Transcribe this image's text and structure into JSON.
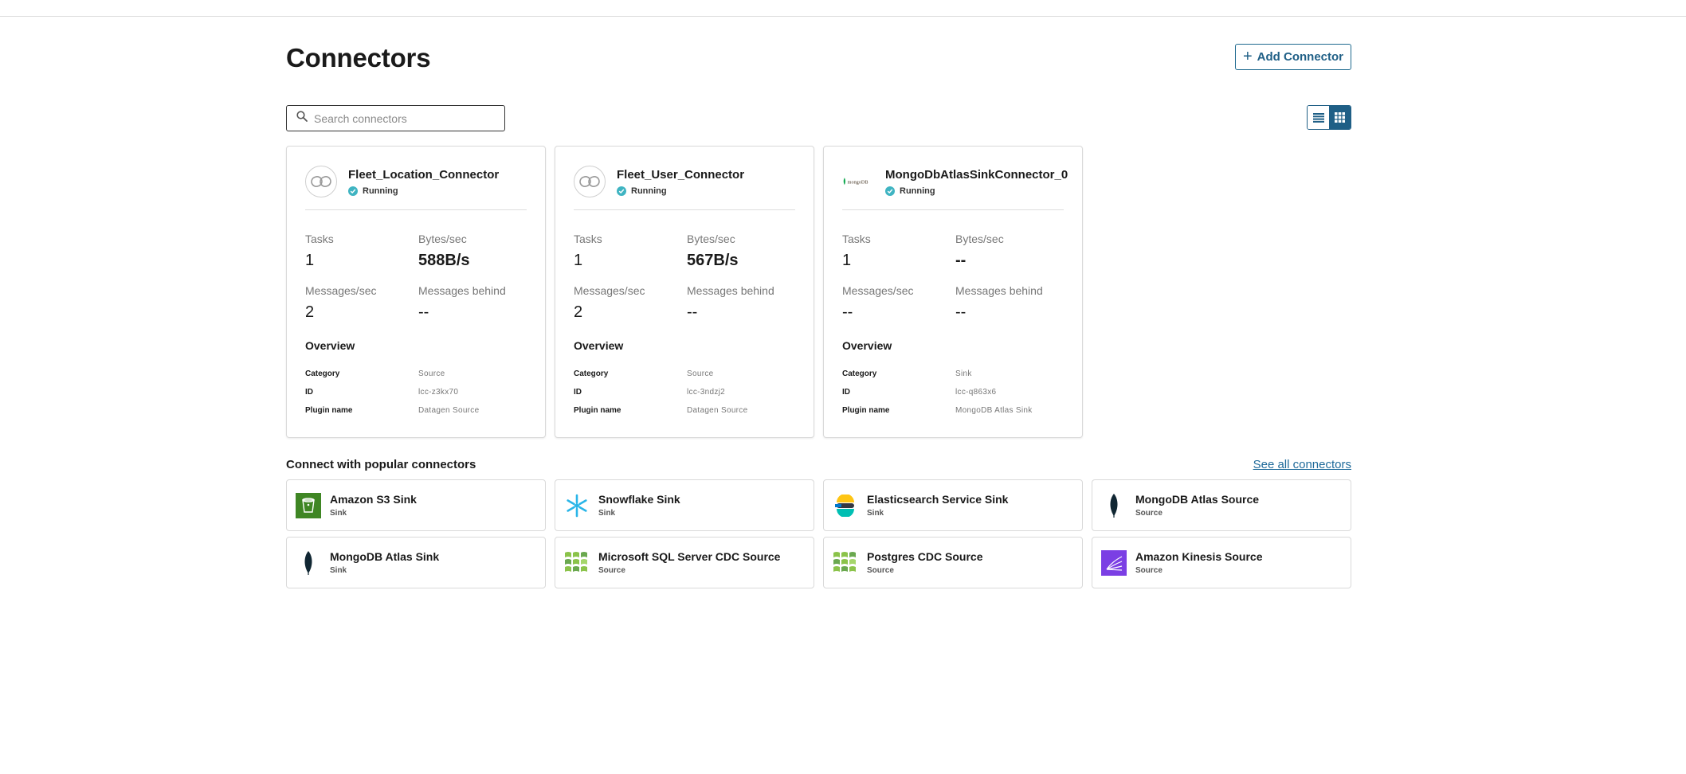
{
  "header": {
    "title": "Connectors",
    "add_button_label": "Add Connector"
  },
  "search": {
    "placeholder": "Search connectors",
    "value": ""
  },
  "view_toggle": {
    "selected": "grid"
  },
  "labels": {
    "tasks": "Tasks",
    "bytes_sec": "Bytes/sec",
    "messages_sec": "Messages/sec",
    "messages_behind": "Messages behind",
    "overview": "Overview",
    "category": "Category",
    "id": "ID",
    "plugin_name": "Plugin name"
  },
  "connectors": [
    {
      "name": "Fleet_Location_Connector",
      "status": "Running",
      "tasks": "1",
      "bytes_sec": "588B/s",
      "messages_sec": "2",
      "messages_behind": "--",
      "category": "Source",
      "id": "lcc-z3kx70",
      "plugin_name": "Datagen Source",
      "logo": "datagen-link-icon"
    },
    {
      "name": "Fleet_User_Connector",
      "status": "Running",
      "tasks": "1",
      "bytes_sec": "567B/s",
      "messages_sec": "2",
      "messages_behind": "--",
      "category": "Source",
      "id": "lcc-3ndzj2",
      "plugin_name": "Datagen Source",
      "logo": "datagen-link-icon"
    },
    {
      "name": "MongoDbAtlasSinkConnector_0",
      "status": "Running",
      "tasks": "1",
      "bytes_sec": "--",
      "messages_sec": "--",
      "messages_behind": "--",
      "category": "Sink",
      "id": "lcc-q863x6",
      "plugin_name": "MongoDB Atlas Sink",
      "logo": "mongodb-logo",
      "logo_text": "mongoDB"
    }
  ],
  "popular": {
    "title": "Connect with popular connectors",
    "see_all": "See all connectors",
    "items": [
      {
        "name": "Amazon S3 Sink",
        "type": "Sink",
        "icon": "amazon-s3-icon"
      },
      {
        "name": "Snowflake Sink",
        "type": "Sink",
        "icon": "snowflake-icon"
      },
      {
        "name": "Elasticsearch Service Sink",
        "type": "Sink",
        "icon": "elasticsearch-icon"
      },
      {
        "name": "MongoDB Atlas Source",
        "type": "Source",
        "icon": "mongodb-leaf-icon"
      },
      {
        "name": "MongoDB Atlas Sink",
        "type": "Sink",
        "icon": "mongodb-leaf-icon"
      },
      {
        "name": "Microsoft SQL Server CDC Source",
        "type": "Source",
        "icon": "debezium-icon"
      },
      {
        "name": "Postgres CDC Source",
        "type": "Source",
        "icon": "debezium-icon"
      },
      {
        "name": "Amazon Kinesis Source",
        "type": "Source",
        "icon": "amazon-kinesis-icon"
      }
    ]
  },
  "colors": {
    "accent": "#1f5f86",
    "link": "#1f6a9a",
    "status_running": "#3fb4c2",
    "border": "#d9d9d9"
  }
}
